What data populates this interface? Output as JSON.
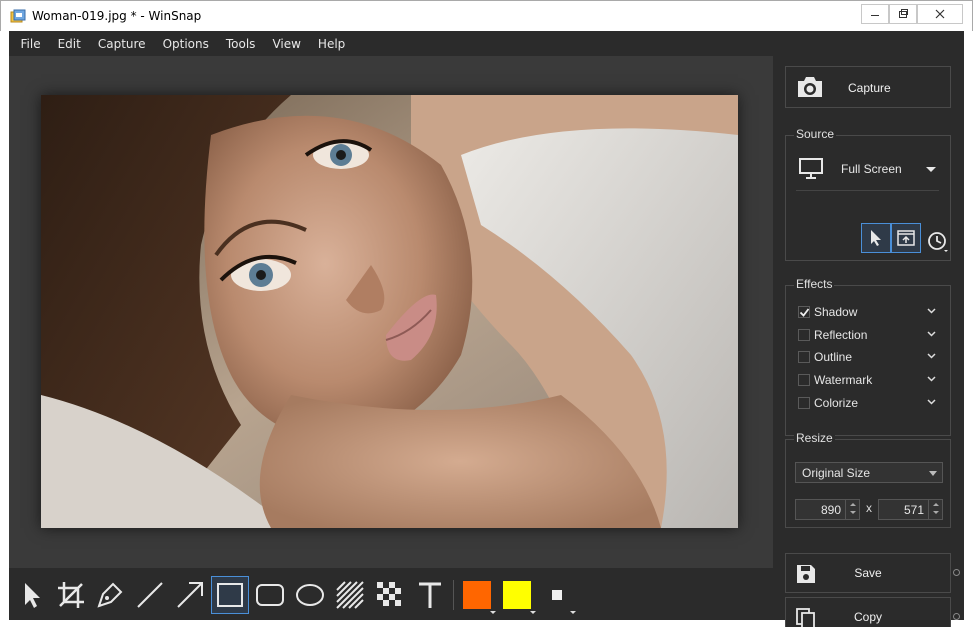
{
  "window": {
    "title": "Woman-019.jpg * - WinSnap"
  },
  "menu": [
    "File",
    "Edit",
    "Capture",
    "Options",
    "Tools",
    "View",
    "Help"
  ],
  "capture": {
    "label": "Capture"
  },
  "source": {
    "title": "Source",
    "selected": "Full Screen"
  },
  "effects": {
    "title": "Effects",
    "items": [
      {
        "label": "Shadow",
        "checked": true
      },
      {
        "label": "Reflection",
        "checked": false
      },
      {
        "label": "Outline",
        "checked": false
      },
      {
        "label": "Watermark",
        "checked": false
      },
      {
        "label": "Colorize",
        "checked": false
      }
    ]
  },
  "resize": {
    "title": "Resize",
    "mode": "Original Size",
    "width": "890",
    "height": "571",
    "separator": "x"
  },
  "actions": {
    "save": "Save",
    "copy": "Copy"
  },
  "toolbar": {
    "tools": [
      "pointer-icon",
      "crop-icon",
      "pen-icon",
      "line-icon",
      "arrow-icon",
      "rectangle-icon",
      "rounded-rectangle-icon",
      "ellipse-icon",
      "hatch-fill-icon",
      "pixelate-icon",
      "text-icon"
    ],
    "selected_tool": "rectangle-icon",
    "primary_color": "#ff6600",
    "secondary_color": "#ffff00"
  },
  "colors": {
    "chrome_bg": "#2b2b2b",
    "canvas_bg": "#3a3a3a",
    "accent": "#4a8fd8"
  }
}
